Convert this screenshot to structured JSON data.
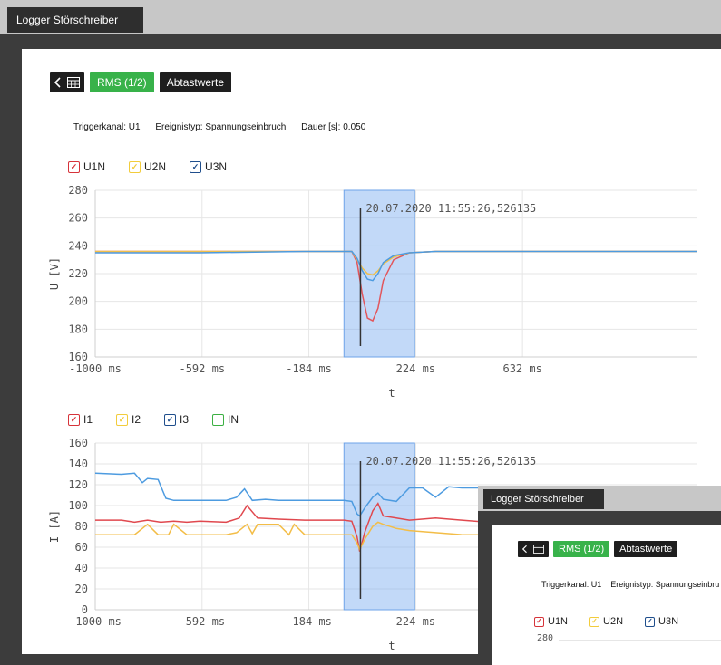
{
  "app": {
    "tab_title": "Logger Störschreiber"
  },
  "toolbar": {
    "rms_label": "RMS (1/2)",
    "samples_label": "Abtastwerte"
  },
  "trigger": {
    "channel": "Triggerkanal: U1",
    "event_type": "Ereignistyp: Spannungseinbruch",
    "duration": "Dauer [s]: 0.050"
  },
  "voltage_legend": [
    {
      "label": "U1N",
      "color": "#d6333a"
    },
    {
      "label": "U2N",
      "color": "#f2cc3c"
    },
    {
      "label": "U3N",
      "color": "#1f4e8c"
    }
  ],
  "current_legend": [
    {
      "label": "I1",
      "color": "#d6333a",
      "checked": true
    },
    {
      "label": "I2",
      "color": "#f2cc3c",
      "checked": true
    },
    {
      "label": "I3",
      "color": "#1f4e8c",
      "checked": true
    },
    {
      "label": "IN",
      "color": "#3cb043",
      "checked": false
    }
  ],
  "colors": {
    "u1": "#e2565c",
    "u2": "#f1c04a",
    "u3": "#4d9be0",
    "i1": "#e0484e",
    "i2": "#f3bd47",
    "i3": "#4d9be0",
    "highlight_fill": "rgba(120,170,240,0.45)",
    "highlight_stroke": "#6ea3e8"
  },
  "chart_data": [
    {
      "type": "line",
      "ylabel": "U [V]",
      "xlabel": "t",
      "ylim": [
        160,
        280
      ],
      "yticks": [
        160,
        180,
        200,
        220,
        240,
        260,
        280
      ],
      "xlim": [
        -1000,
        1300
      ],
      "xtick_labels": [
        "-1000 ms",
        "-592 ms",
        "-184 ms",
        "224 ms",
        "632 ms"
      ],
      "xticks": [
        -1000,
        -592,
        -184,
        224,
        632
      ],
      "grid": true,
      "highlight_range": [
        -50,
        220
      ],
      "trigger_x": 13,
      "annotation": "20.07.2020 11:55:26,526135",
      "series": [
        {
          "name": "U1N",
          "x": [
            -1000,
            -600,
            -200,
            -20,
            0,
            20,
            40,
            60,
            80,
            100,
            140,
            200,
            300,
            600,
            1300
          ],
          "y": [
            236,
            236,
            236,
            236,
            228,
            205,
            188,
            186,
            195,
            215,
            230,
            235,
            236,
            236,
            236
          ]
        },
        {
          "name": "U2N",
          "x": [
            -1000,
            -600,
            -200,
            -20,
            0,
            20,
            40,
            60,
            80,
            100,
            140,
            200,
            300,
            600,
            1300
          ],
          "y": [
            236,
            236,
            236,
            236,
            230,
            224,
            220,
            219,
            222,
            227,
            232,
            235,
            236,
            236,
            236
          ]
        },
        {
          "name": "U3N",
          "x": [
            -1000,
            -600,
            -200,
            -20,
            0,
            20,
            40,
            60,
            80,
            100,
            140,
            200,
            300,
            600,
            1300
          ],
          "y": [
            235,
            235,
            236,
            236,
            231,
            222,
            216,
            215,
            220,
            228,
            233,
            235,
            236,
            236,
            236
          ]
        }
      ]
    },
    {
      "type": "line",
      "ylabel": "I [A]",
      "xlabel": "t",
      "ylim": [
        0,
        160
      ],
      "yticks": [
        0,
        20,
        40,
        60,
        80,
        100,
        120,
        140,
        160
      ],
      "xlim": [
        -1000,
        1300
      ],
      "xtick_labels": [
        "-1000 ms",
        "-592 ms",
        "-184 ms",
        "224 ms"
      ],
      "xticks": [
        -1000,
        -592,
        -184,
        224
      ],
      "grid": true,
      "highlight_range": [
        -50,
        220
      ],
      "trigger_x": 13,
      "annotation": "20.07.2020 11:55:26,526135",
      "series": [
        {
          "name": "I1",
          "x": [
            -1000,
            -900,
            -850,
            -800,
            -750,
            -700,
            -650,
            -600,
            -500,
            -450,
            -420,
            -380,
            -300,
            -200,
            -100,
            -50,
            -20,
            0,
            10,
            30,
            60,
            80,
            100,
            150,
            200,
            300,
            400,
            500,
            600
          ],
          "y": [
            86,
            86,
            84,
            86,
            84,
            85,
            84,
            85,
            84,
            88,
            100,
            88,
            87,
            86,
            86,
            86,
            85,
            70,
            56,
            75,
            95,
            102,
            90,
            88,
            86,
            88,
            86,
            84,
            84
          ]
        },
        {
          "name": "I2",
          "x": [
            -1000,
            -900,
            -850,
            -800,
            -760,
            -720,
            -700,
            -650,
            -600,
            -500,
            -460,
            -420,
            -400,
            -380,
            -340,
            -300,
            -260,
            -240,
            -200,
            -100,
            -50,
            -20,
            0,
            10,
            30,
            60,
            80,
            100,
            150,
            200,
            300,
            400,
            500,
            600
          ],
          "y": [
            72,
            72,
            72,
            82,
            72,
            72,
            82,
            72,
            72,
            72,
            74,
            82,
            73,
            82,
            82,
            82,
            72,
            82,
            72,
            72,
            72,
            72,
            64,
            58,
            68,
            80,
            84,
            82,
            78,
            76,
            74,
            72,
            72,
            72
          ]
        },
        {
          "name": "I3",
          "x": [
            -1000,
            -900,
            -850,
            -820,
            -800,
            -760,
            -730,
            -700,
            -600,
            -500,
            -460,
            -430,
            -400,
            -350,
            -300,
            -200,
            -100,
            -50,
            -20,
            0,
            10,
            30,
            60,
            80,
            100,
            150,
            200,
            250,
            300,
            350,
            400,
            500,
            600
          ],
          "y": [
            131,
            130,
            131,
            122,
            126,
            125,
            107,
            105,
            105,
            105,
            108,
            116,
            105,
            106,
            105,
            105,
            105,
            105,
            104,
            92,
            90,
            98,
            108,
            112,
            106,
            104,
            117,
            117,
            108,
            118,
            117,
            117,
            117
          ]
        }
      ]
    }
  ],
  "small_window": {
    "tab_title": "Logger Störschreiber",
    "rms_label": "RMS (1/2)",
    "samples_label": "Abtastwerte",
    "trigger_channel": "Triggerkanal: U1",
    "event_type": "Ereignistyp: Spannungseinbru",
    "legend": [
      "U1N",
      "U2N",
      "U3N"
    ],
    "first_tick": "280"
  }
}
